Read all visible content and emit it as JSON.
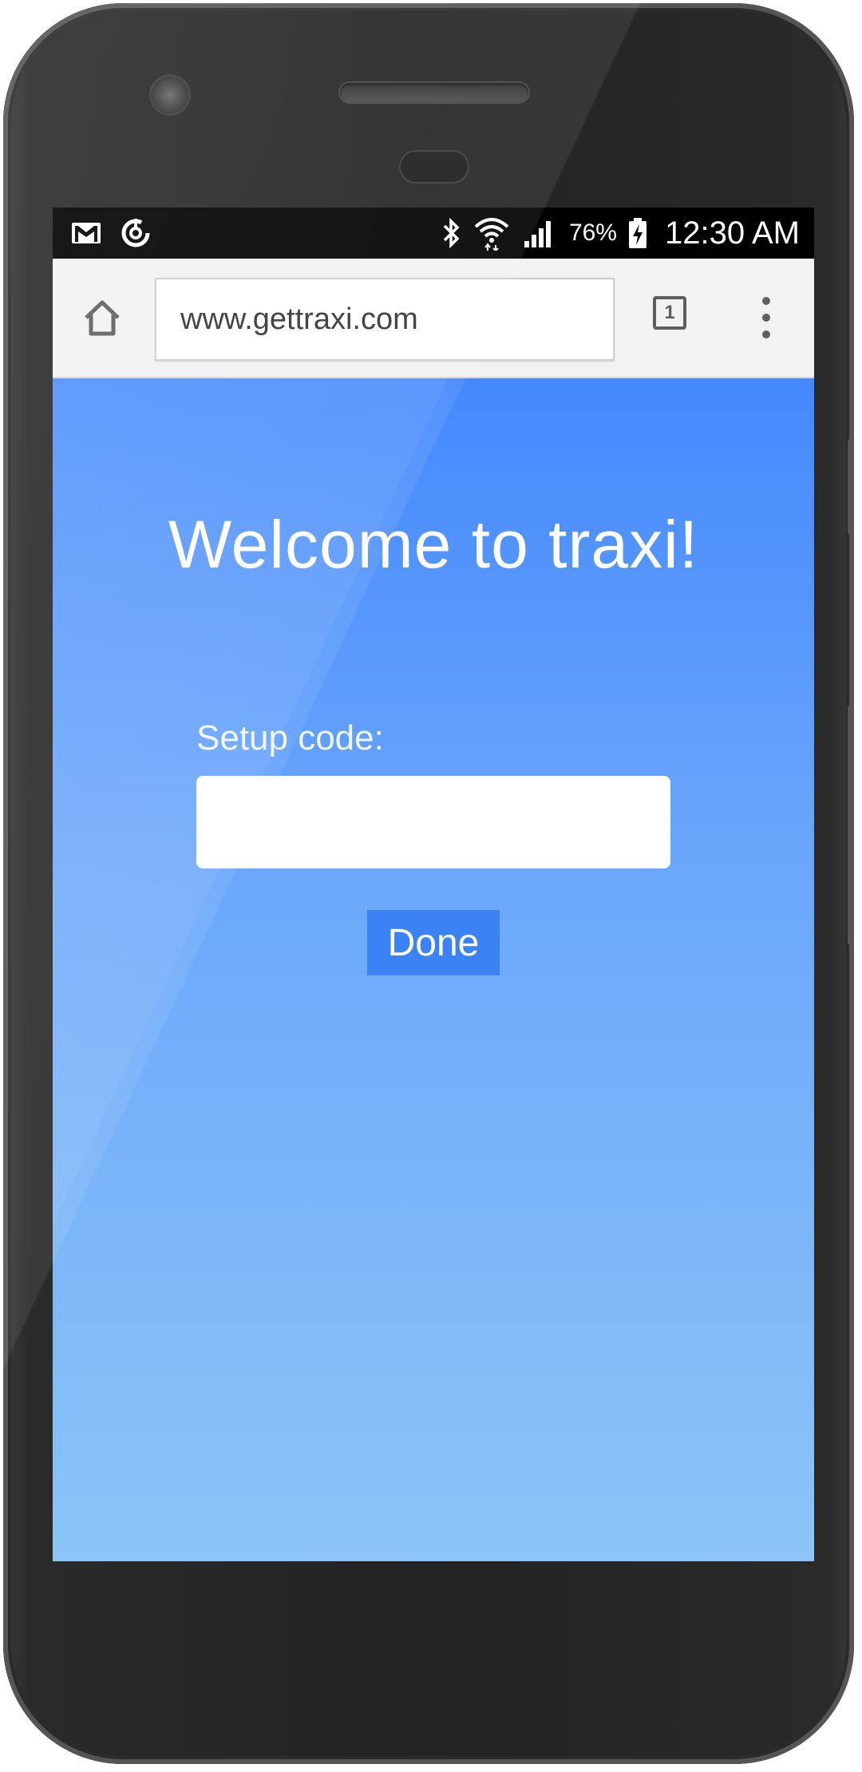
{
  "status_bar": {
    "battery_percent": "76%",
    "time": "12:30 AM",
    "left_icons": [
      "gmail-icon",
      "sync-icon"
    ],
    "right_icons": [
      "bluetooth-icon",
      "wifi-icon",
      "cell-signal-icon",
      "battery-charging-icon"
    ]
  },
  "browser": {
    "url": "www.gettraxi.com",
    "tab_count": "1",
    "home_icon": "home-icon",
    "menu_icon": "overflow-menu-icon"
  },
  "page": {
    "welcome_title": "Welcome to traxi!",
    "setup_label": "Setup code:",
    "setup_value": "",
    "setup_placeholder": "",
    "done_label": "Done"
  },
  "colors": {
    "gradient_top": "#4489fd",
    "gradient_bottom": "#8cc5f7",
    "button": "#3b83f5"
  }
}
